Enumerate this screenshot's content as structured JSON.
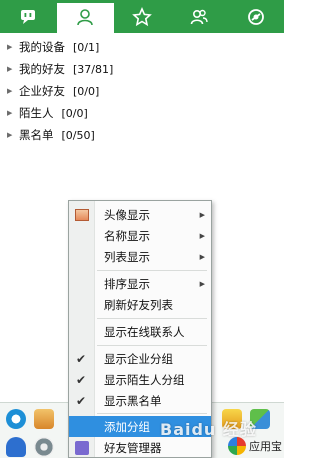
{
  "tabs": [
    {
      "icon": "chat-bubble-icon"
    },
    {
      "icon": "contact-person-icon",
      "active": true
    },
    {
      "icon": "star-icon"
    },
    {
      "icon": "group-people-icon"
    },
    {
      "icon": "qzone-icon"
    }
  ],
  "groups": [
    {
      "name": "我的设备",
      "count": "[0/1]"
    },
    {
      "name": "我的好友",
      "count": "[37/81]"
    },
    {
      "name": "企业好友",
      "count": "[0/0]"
    },
    {
      "name": "陌生人",
      "count": "[0/0]"
    },
    {
      "name": "黑名单",
      "count": "[0/50]"
    }
  ],
  "menu": {
    "items": [
      {
        "label": "头像显示",
        "submenu": true
      },
      {
        "label": "名称显示",
        "submenu": true
      },
      {
        "label": "列表显示",
        "submenu": true
      },
      {
        "label": "排序显示",
        "submenu": true
      },
      {
        "label": "刷新好友列表"
      },
      {
        "label": "显示在线联系人"
      },
      {
        "label": "显示企业分组",
        "checked": true
      },
      {
        "label": "显示陌生人分组",
        "checked": true
      },
      {
        "label": "显示黑名单",
        "checked": true
      },
      {
        "label": "添加分组",
        "highlighted": true
      },
      {
        "label": "好友管理器"
      }
    ]
  },
  "bottom": {
    "appstore_label": "应用宝"
  },
  "watermark": "Baidu 经验",
  "colors": {
    "tab_green": "#2f9c47",
    "highlight_blue": "#2f8fe0"
  }
}
